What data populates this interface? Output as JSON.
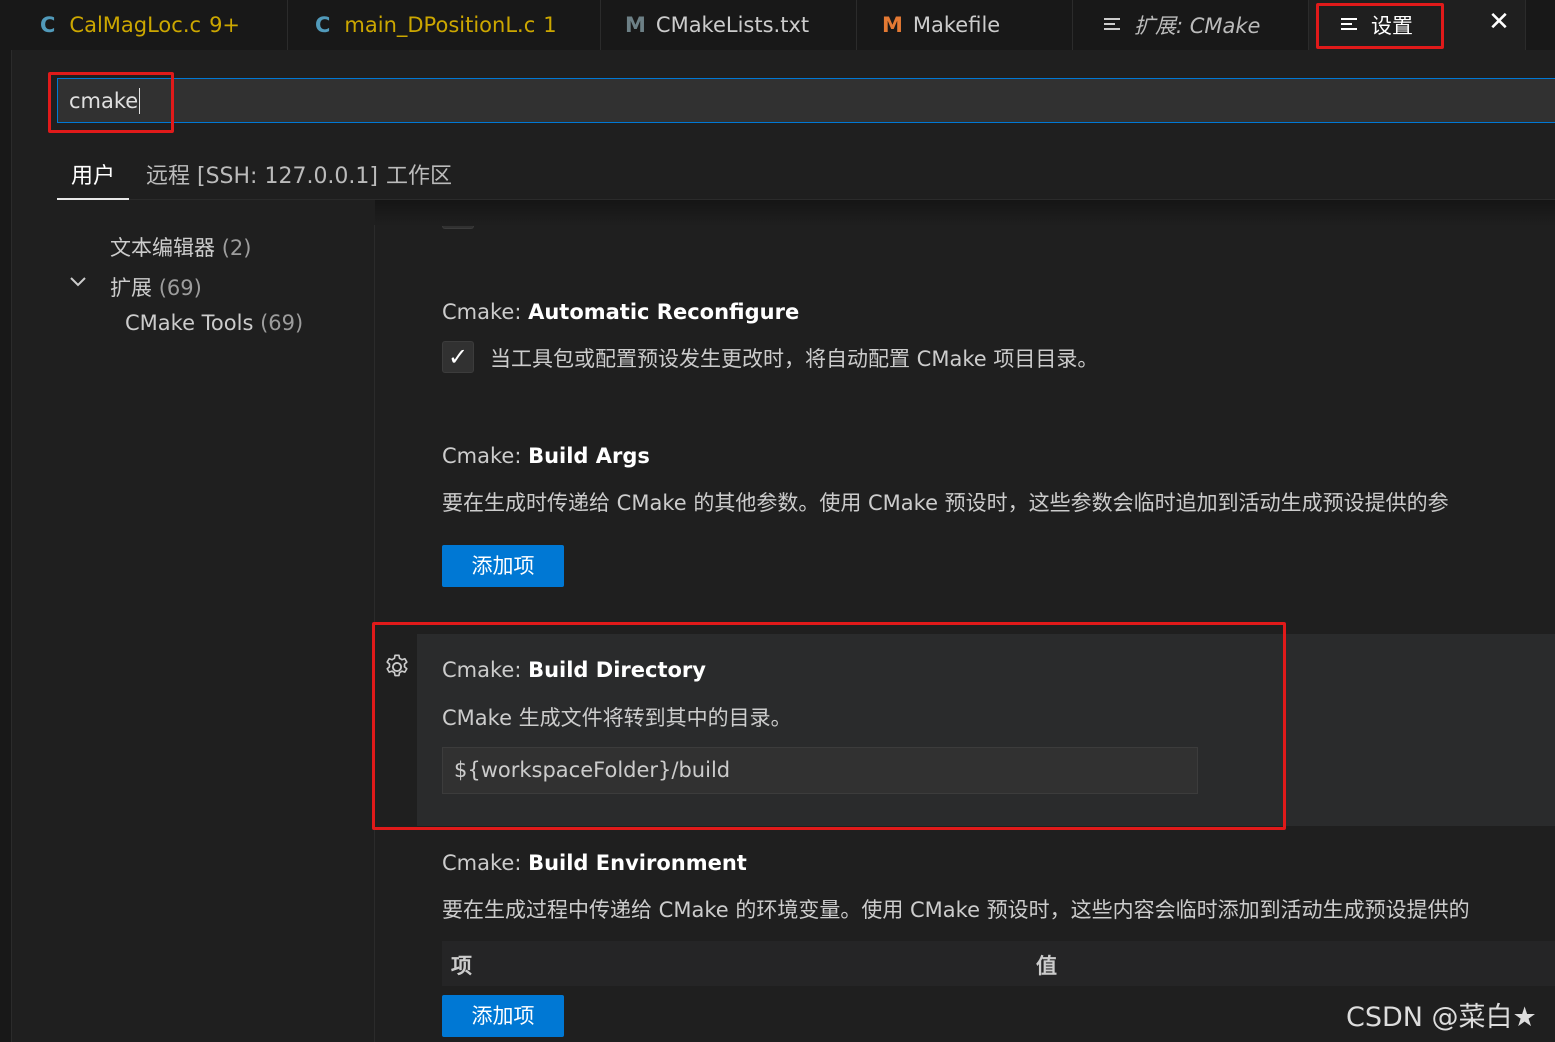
{
  "tabs": [
    {
      "icon": "C",
      "label": "CalMagLoc.c",
      "badge": "9+"
    },
    {
      "icon": "C",
      "label": "main_DPositionL.c",
      "badge": "1"
    },
    {
      "icon": "M",
      "label": "CMakeLists.txt"
    },
    {
      "icon": "M",
      "label": "Makefile"
    },
    {
      "label": "扩展: CMake"
    },
    {
      "label": "设置"
    }
  ],
  "colors": {
    "c_icon": "#519aba",
    "cmake_icon": "#6d8086",
    "makefile_icon": "#e37933",
    "warning": "#cca700",
    "accent": "#0078d4",
    "annotation": "#e01a1a"
  },
  "search": {
    "value": "cmake"
  },
  "scopes": [
    "用户",
    "远程 [SSH: 127.0.0.1]",
    "工作区"
  ],
  "toc": [
    {
      "label": "文本编辑器",
      "count": "(2)"
    },
    {
      "label": "扩展",
      "count": "(69)"
    },
    {
      "label": "CMake Tools",
      "count": "(69)"
    }
  ],
  "settings": {
    "auto_reconfigure": {
      "category": "Cmake: ",
      "name": "Automatic Reconfigure",
      "desc": "当工具包或配置预设发生更改时，将自动配置 CMake 项目目录。",
      "checked": true
    },
    "build_args": {
      "category": "Cmake: ",
      "name": "Build Args",
      "desc": "要在生成时传递给 CMake 的其他参数。使用 CMake 预设时，这些参数会临时追加到活动生成预设提供的参",
      "button": "添加项"
    },
    "build_directory": {
      "category": "Cmake: ",
      "name": "Build Directory",
      "desc": "CMake 生成文件将转到其中的目录。",
      "value": "${workspaceFolder}/build"
    },
    "build_environment": {
      "category": "Cmake: ",
      "name": "Build Environment",
      "desc": "要在生成过程中传递给 CMake 的环境变量。使用 CMake 预设时，这些内容会临时添加到活动生成预设提供的",
      "col_item": "项",
      "col_value": "值",
      "button": "添加项"
    }
  },
  "watermark": "CSDN @菜白★"
}
